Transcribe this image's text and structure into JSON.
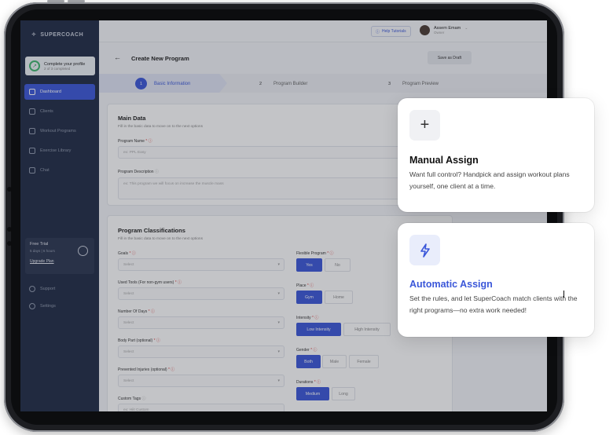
{
  "app": {
    "logo_text": "SUPERCOACH",
    "page_title": "Create New Program",
    "save_draft_label": "Save as Draft",
    "help_label": "Help Tutorials",
    "user": {
      "name": "Assem Emam",
      "role": "Owner"
    }
  },
  "sidebar": {
    "profile": {
      "title": "Complete your profile",
      "progress": "2 of 3 completed"
    },
    "items": [
      {
        "label": "Dashboard",
        "icon": "dashboard-icon",
        "active": true
      },
      {
        "label": "Clients",
        "icon": "clients-icon"
      },
      {
        "label": "Workout Programs",
        "icon": "dumbbell-icon"
      },
      {
        "label": "Exercise Library",
        "icon": "library-icon"
      },
      {
        "label": "Chat",
        "icon": "chat-icon"
      }
    ],
    "trial": {
      "title": "Free Trial",
      "remaining": "5 days | 6 hours",
      "upgrade": "Upgrade Plan"
    },
    "bottom": [
      {
        "label": "Support",
        "icon": "support-icon"
      },
      {
        "label": "Settings",
        "icon": "settings-icon"
      }
    ]
  },
  "stepper": [
    {
      "num": "1",
      "label": "Basic Information"
    },
    {
      "num": "2",
      "label": "Program Builder"
    },
    {
      "num": "3",
      "label": "Program Preview"
    }
  ],
  "main_data": {
    "title": "Main Data",
    "subtitle": "Fill in the basic data to move on to the next options",
    "name_label": "Program Name",
    "name_placeholder": "ex: PPL Easy",
    "desc_label": "Program Description",
    "desc_placeholder": "ex: This program we will focus on increase the muscle mass"
  },
  "classifications": {
    "title": "Program Classifications",
    "subtitle": "Fill in the basic data to move on to the next options",
    "select_placeholder": "Select",
    "goals_label": "Goals",
    "tools_label": "Used Tools (For non-gym users)",
    "days_label": "Number Of Days",
    "body_label": "Body Part (optional)",
    "injuries_label": "Prevented Injuries (optional)",
    "tags_label": "Custom Tags",
    "tags_placeholder": "ex: Hiit Custom",
    "flexible": {
      "label": "Flexible Program",
      "options": [
        "Yes",
        "No"
      ]
    },
    "place": {
      "label": "Place",
      "options": [
        "Gym",
        "Home"
      ]
    },
    "intensity": {
      "label": "Intensity",
      "options": [
        "Low Intensity",
        "High Intensity"
      ]
    },
    "gender": {
      "label": "Gender",
      "options": [
        "Both",
        "Male",
        "Female"
      ]
    },
    "durations": {
      "label": "Durations",
      "options": [
        "Medium",
        "Long"
      ]
    }
  },
  "cards": {
    "manual": {
      "icon": "plus-icon",
      "title": "Manual Assign",
      "desc": "Want full control? Handpick and assign workout plans yourself, one client at a time."
    },
    "automatic": {
      "icon": "lightning-icon",
      "title": "Automatic Assign",
      "desc": "Set the rules, and let SuperCoach match clients with the right programs—no extra work needed!"
    }
  },
  "colors": {
    "accent": "#3b57d9",
    "sidebar": "#1f2a44"
  }
}
